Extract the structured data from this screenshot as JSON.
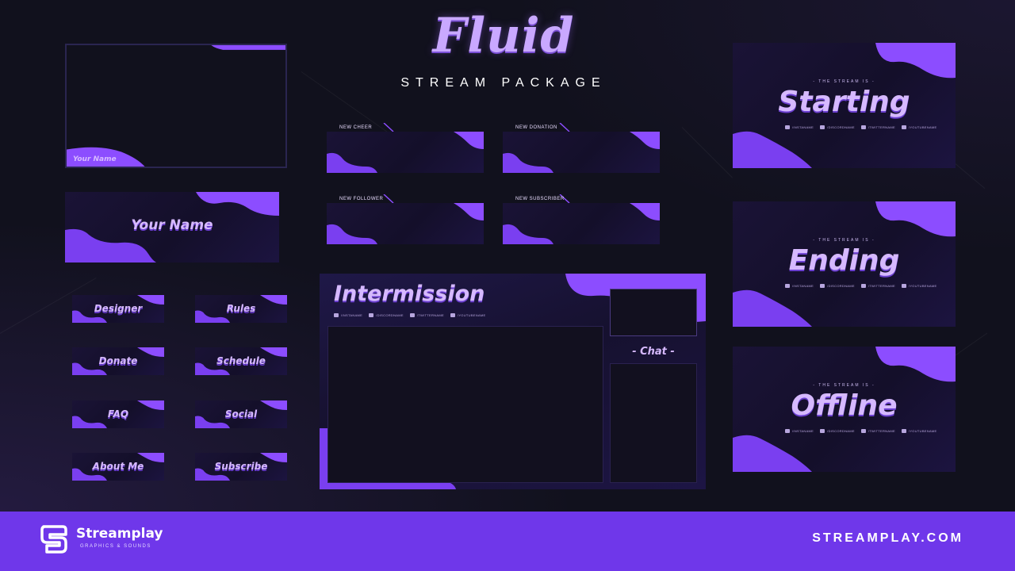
{
  "header": {
    "title": "Fluid",
    "subtitle": "STREAM PACKAGE"
  },
  "webcam": {
    "name_label": "Your Name"
  },
  "banner": {
    "label": "Your Name"
  },
  "panels": [
    {
      "label": "Designer"
    },
    {
      "label": "Rules"
    },
    {
      "label": "Donate"
    },
    {
      "label": "Schedule"
    },
    {
      "label": "FAQ"
    },
    {
      "label": "Social"
    },
    {
      "label": "About Me"
    },
    {
      "label": "Subscribe"
    }
  ],
  "alerts": [
    {
      "label": "NEW CHEER"
    },
    {
      "label": "NEW DONATION"
    },
    {
      "label": "NEW FOLLOWER"
    },
    {
      "label": "NEW SUBSCRIBER"
    }
  ],
  "intermission": {
    "title": "Intermission",
    "chat_label": "- Chat -",
    "socials": [
      "/INSTANAME",
      "/DISCORDNAME",
      "/TWITTERNAME",
      "/YOUTUBENAME"
    ]
  },
  "screens": [
    {
      "tag": "- THE STREAM IS -",
      "title": "Starting"
    },
    {
      "tag": "- THE STREAM IS -",
      "title": "Ending"
    },
    {
      "tag": "- THE STREAM IS -",
      "title": "Offline"
    }
  ],
  "screen_socials": [
    "/INSTANAME",
    "/DISCORDNAME",
    "/TWITTERNAME",
    "/YOUTUBENAME"
  ],
  "footer": {
    "brand": "Streamplay",
    "tagline": "GRAPHICS & SOUNDS",
    "site": "STREAMPLAY.COM"
  },
  "colors": {
    "accent": "#6f37ea",
    "fluid_purple": "#8c4dff",
    "background": "#11111d"
  }
}
